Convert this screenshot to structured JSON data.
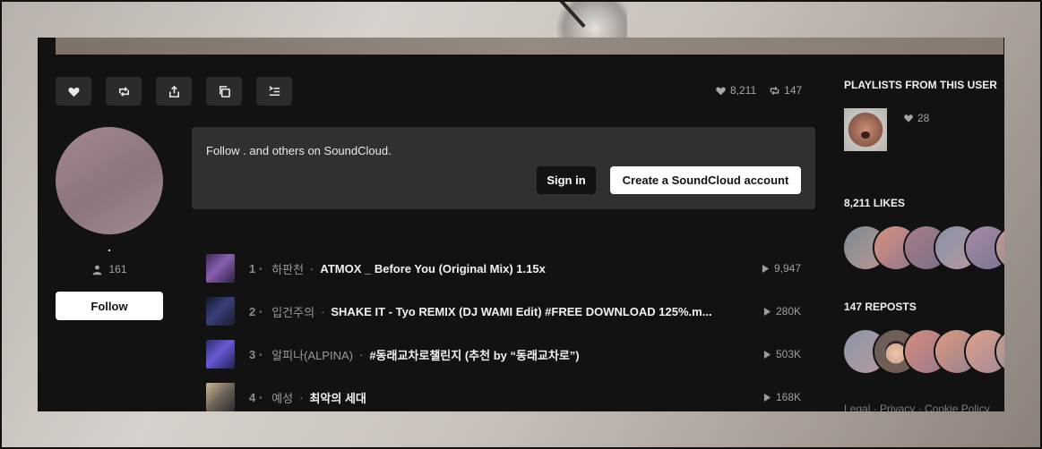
{
  "colors": {
    "panel_bg": "#121212",
    "button_bg": "#2b2b2b",
    "signup_bg": "#303030",
    "text_primary": "#f2f2f2",
    "text_muted": "#9a9a9a"
  },
  "actions": [
    {
      "name": "like-button",
      "icon": "heart-icon"
    },
    {
      "name": "repost-button",
      "icon": "repost-icon"
    },
    {
      "name": "share-button",
      "icon": "share-icon"
    },
    {
      "name": "copy-link-button",
      "icon": "copy-icon"
    },
    {
      "name": "add-to-next-up-button",
      "icon": "queue-icon"
    }
  ],
  "stats": {
    "likes": "8,211",
    "reposts": "147"
  },
  "user": {
    "name": ".",
    "followers": "161",
    "follow_label": "Follow"
  },
  "signup": {
    "message": "Follow . and others on SoundCloud.",
    "signin_label": "Sign in",
    "create_label": "Create a SoundCloud account"
  },
  "tracks": [
    {
      "num": "1",
      "artist": "하판천",
      "title": "ATMOX _ Before You (Original Mix) 1.15x",
      "plays": "9,947"
    },
    {
      "num": "2",
      "artist": "입건주의",
      "title": "SHAKE IT - Tyo REMIX (DJ WAMI Edit) #FREE DOWNLOAD 125%.m...",
      "plays": "280K"
    },
    {
      "num": "3",
      "artist": "알피나(ALPINA)",
      "title": "#동래교차로챌린지 (추천 by “동래교차로”)",
      "plays": "503K"
    },
    {
      "num": "4",
      "artist": "예성",
      "title": "최악의 세대",
      "plays": "168K"
    }
  ],
  "sidebar": {
    "playlists_heading": "PLAYLISTS FROM THIS USER",
    "playlist_likes": "28",
    "likes_heading": "8,211 LIKES",
    "reposts_heading": "147 REPOSTS",
    "footer": "Legal · Privacy · Cookie Policy"
  }
}
